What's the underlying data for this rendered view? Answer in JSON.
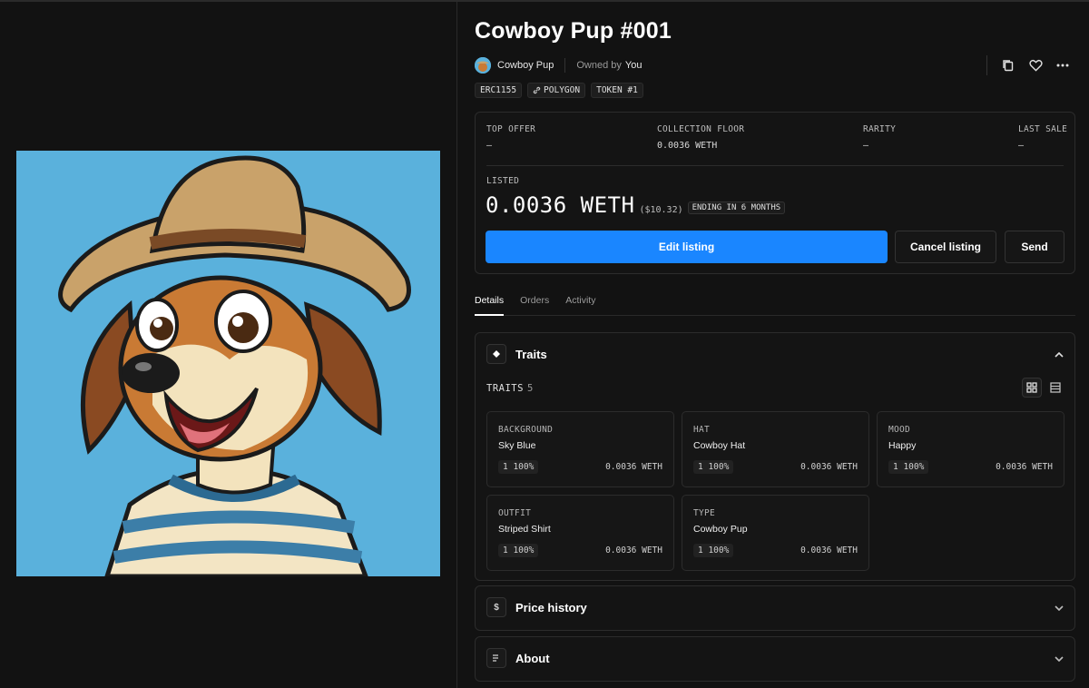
{
  "item": {
    "title": "Cowboy Pup #001",
    "collection": "Cowboy Pup",
    "owned_by_label": "Owned by",
    "owner": "You"
  },
  "badges": [
    {
      "label": "ERC1155"
    },
    {
      "label": "POLYGON",
      "icon": "link-icon"
    },
    {
      "label": "TOKEN #1"
    }
  ],
  "stats": {
    "top_offer": {
      "label": "TOP OFFER",
      "value": "–"
    },
    "collection_floor": {
      "label": "COLLECTION FLOOR",
      "value": "0.0036 WETH"
    },
    "rarity": {
      "label": "RARITY",
      "value": "–"
    },
    "last_sale": {
      "label": "LAST SALE",
      "value": "–"
    }
  },
  "listing": {
    "label": "LISTED",
    "price": "0.0036 WETH",
    "usd": "($10.32)",
    "ending": "ENDING IN 6 MONTHS",
    "edit_label": "Edit listing",
    "cancel_label": "Cancel listing",
    "send_label": "Send"
  },
  "tabs": [
    {
      "label": "Details",
      "active": true
    },
    {
      "label": "Orders",
      "active": false
    },
    {
      "label": "Activity",
      "active": false
    }
  ],
  "traits_panel": {
    "title": "Traits",
    "count_label": "TRAITS",
    "count": "5",
    "items": [
      {
        "type": "BACKGROUND",
        "value": "Sky Blue",
        "count": "1 100%",
        "floor": "0.0036 WETH"
      },
      {
        "type": "HAT",
        "value": "Cowboy Hat",
        "count": "1 100%",
        "floor": "0.0036 WETH"
      },
      {
        "type": "MOOD",
        "value": "Happy",
        "count": "1 100%",
        "floor": "0.0036 WETH"
      },
      {
        "type": "OUTFIT",
        "value": "Striped Shirt",
        "count": "1 100%",
        "floor": "0.0036 WETH"
      },
      {
        "type": "TYPE",
        "value": "Cowboy Pup",
        "count": "1 100%",
        "floor": "0.0036 WETH"
      }
    ]
  },
  "price_history_panel": {
    "title": "Price history",
    "icon": "dollar-icon"
  },
  "about_panel": {
    "title": "About",
    "icon": "document-icon"
  },
  "icons": [
    "copy-icon",
    "heart-icon",
    "more-icon",
    "diamond-icon",
    "chevron-up-icon",
    "grid-view-icon",
    "list-view-icon",
    "chevron-down-icon"
  ],
  "colors": {
    "accent": "#1a86ff",
    "background": "#121212",
    "image_background": "#5ab1dc"
  }
}
